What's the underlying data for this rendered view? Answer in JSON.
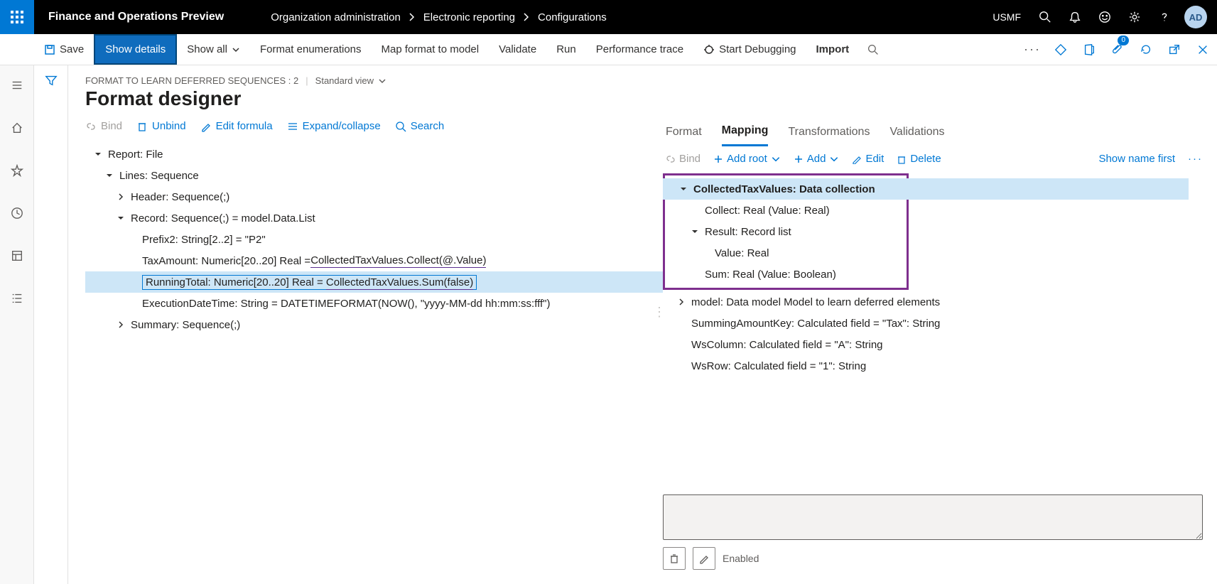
{
  "header": {
    "app_title": "Finance and Operations Preview",
    "breadcrumb1": "Organization administration",
    "breadcrumb2": "Electronic reporting",
    "breadcrumb3": "Configurations",
    "legal_entity": "USMF",
    "avatar": "AD"
  },
  "commands": {
    "save": "Save",
    "show_details": "Show details",
    "show_all": "Show all",
    "format_enum": "Format enumerations",
    "map_format": "Map format to model",
    "validate": "Validate",
    "run": "Run",
    "perf_trace": "Performance trace",
    "start_debug": "Start Debugging",
    "import": "Import",
    "attach_count": "0"
  },
  "page": {
    "path": "FORMAT TO LEARN DEFERRED SEQUENCES : 2",
    "view": "Standard view",
    "title": "Format designer"
  },
  "left_toolbar": {
    "bind": "Bind",
    "unbind": "Unbind",
    "edit_formula": "Edit formula",
    "expand": "Expand/collapse",
    "search": "Search"
  },
  "left_tree": {
    "r1": "Report: File",
    "r2": "Lines: Sequence",
    "r3": "Header: Sequence(;)",
    "r4": "Record: Sequence(;) = model.Data.List",
    "r5": "Prefix2: String[2..2] = \"P2\"",
    "r6a": "TaxAmount: Numeric[20..20] Real = ",
    "r6b": "CollectedTaxValues.Collect(@.Value)",
    "r7a": "RunningTotal: Numeric[20..20] Real = ",
    "r7b": "CollectedTaxValues.Sum(false)",
    "r8": "ExecutionDateTime: String = DATETIMEFORMAT(NOW(), \"yyyy-MM-dd hh:mm:ss:fff\")",
    "r9": "Summary: Sequence(;)"
  },
  "tabs": {
    "format": "Format",
    "mapping": "Mapping",
    "transformations": "Transformations",
    "validations": "Validations"
  },
  "right_toolbar": {
    "bind": "Bind",
    "add_root": "Add root",
    "add": "Add",
    "edit": "Edit",
    "delete": "Delete",
    "show_name": "Show name first"
  },
  "right_tree": {
    "r1": "CollectedTaxValues: Data collection",
    "r2": "Collect: Real (Value: Real)",
    "r3": "Result: Record list",
    "r4": "Value: Real",
    "r5": "Sum: Real (Value: Boolean)",
    "r6": "model: Data model Model to learn deferred elements",
    "r7": "SummingAmountKey: Calculated field = \"Tax\": String",
    "r8": "WsColumn: Calculated field = \"A\": String",
    "r9": "WsRow: Calculated field = \"1\": String"
  },
  "bottom": {
    "enabled": "Enabled"
  }
}
